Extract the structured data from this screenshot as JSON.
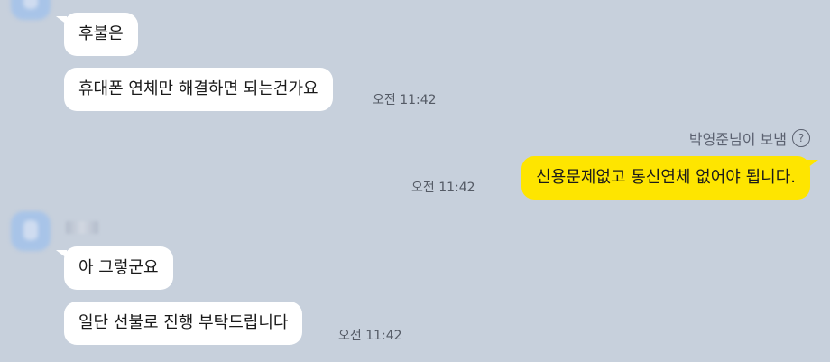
{
  "messages": [
    {
      "text": "후불은",
      "time": ""
    },
    {
      "text": "휴대폰 연체만 해결하면 되는건가요",
      "time": "오전 11:42"
    },
    {
      "text": "신용문제없고 통신연체 없어야 됩니다.",
      "time": "오전 11:42",
      "status": "박영준님이 보냄"
    },
    {
      "text": "아 그렇군요",
      "time": ""
    },
    {
      "text": "일단 선불로 진행 부탁드립니다",
      "time": "오전 11:42"
    }
  ],
  "icons": {
    "help": "?"
  },
  "colors": {
    "background": "#c7d0dc",
    "incoming_bubble": "#ffffff",
    "outgoing_bubble": "#fee500"
  }
}
